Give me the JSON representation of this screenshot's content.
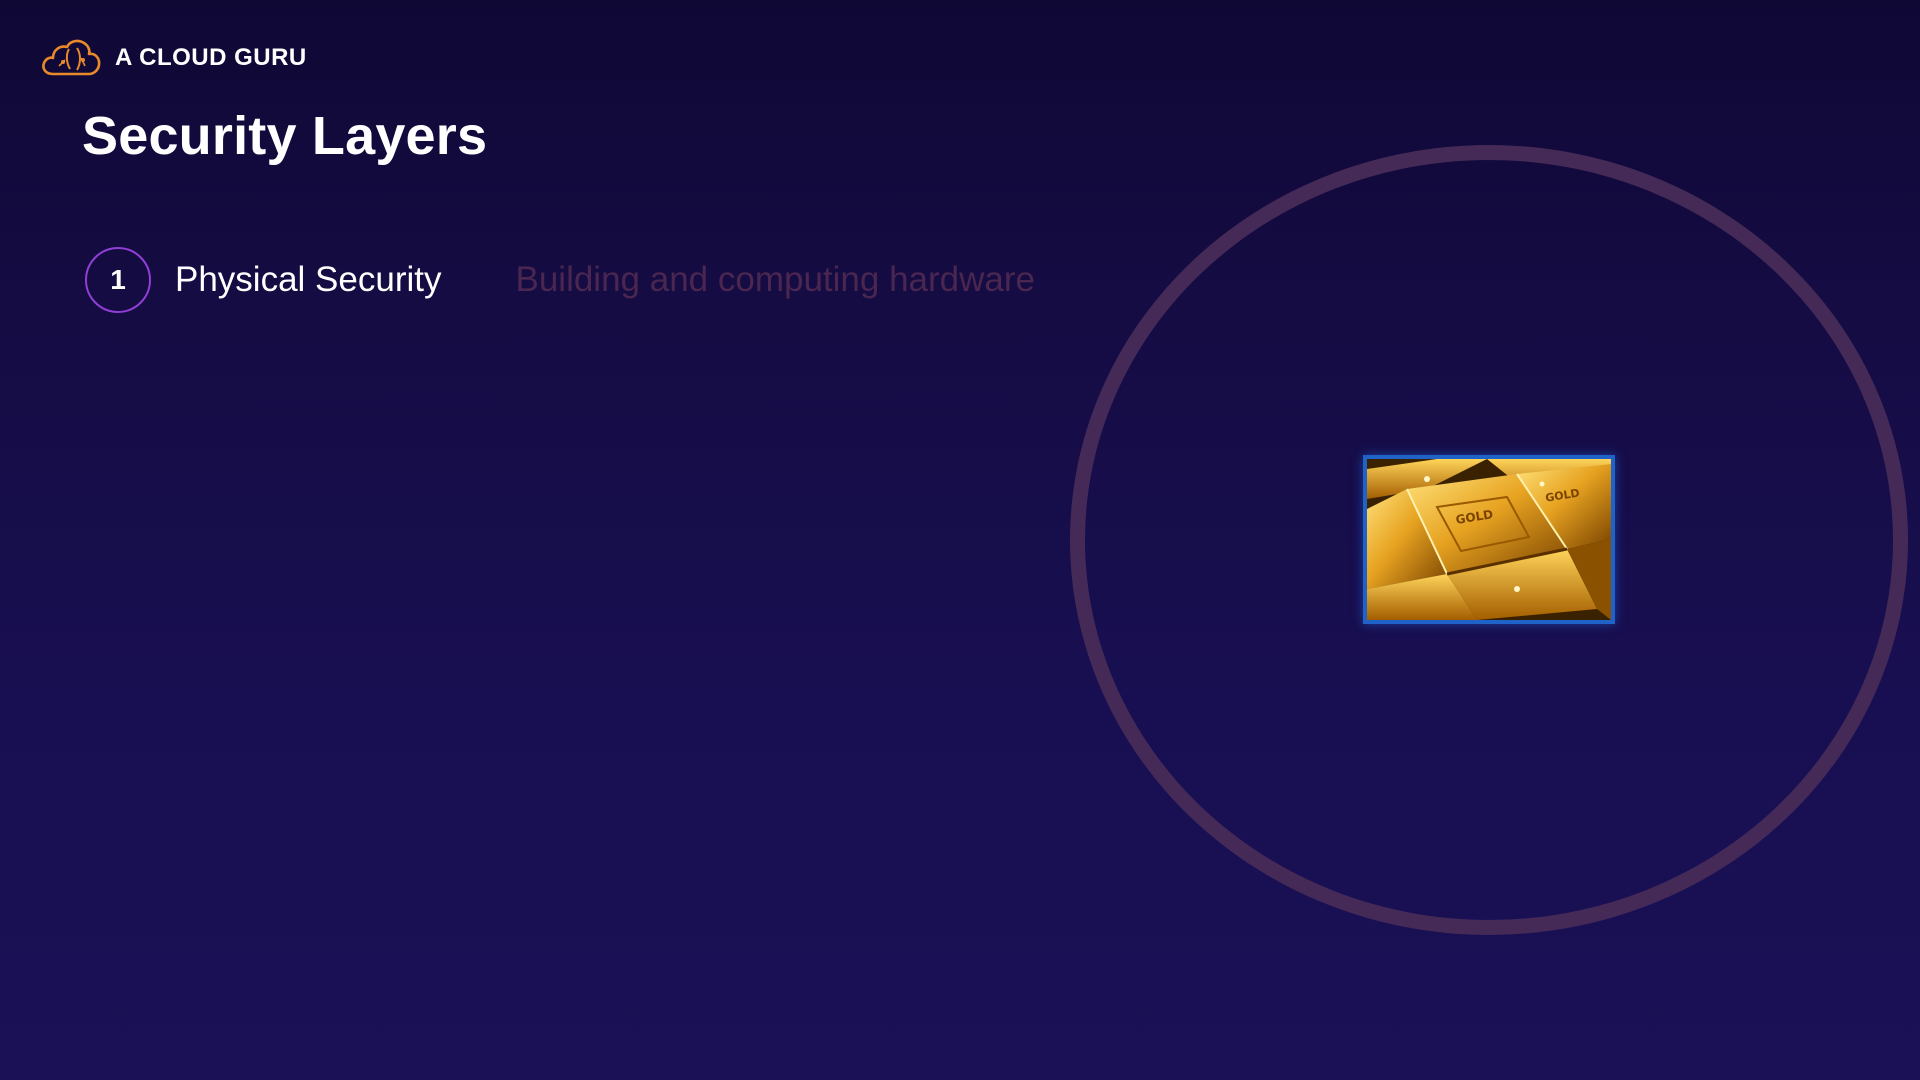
{
  "brand": {
    "logo_icon": "cloud-brain-icon",
    "name": "A CLOUD GURU"
  },
  "slide": {
    "title": "Security Layers"
  },
  "layers": [
    {
      "number": "1",
      "name": "Physical Security",
      "description": "Building and computing hardware"
    }
  ],
  "diagram": {
    "ring_color": "#452a58",
    "image_subject": "gold-bars-image",
    "image_engraving": "GOLD",
    "image_border_color": "#1f63c8"
  },
  "colors": {
    "background_top": "#0f0835",
    "background_bottom": "#1a1156",
    "accent_purple": "#8f3fd4",
    "brand_orange": "#e8892b",
    "description_muted": "#4a2650"
  }
}
